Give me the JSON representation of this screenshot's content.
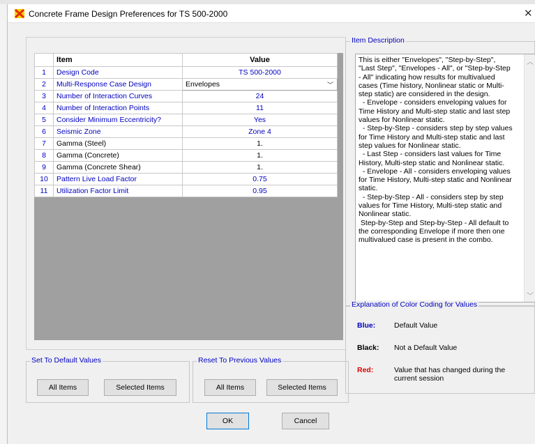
{
  "window": {
    "title": "Concrete Frame Design Preferences for TS 500-2000"
  },
  "grid": {
    "headers": [
      "",
      "Item",
      "Value"
    ],
    "rows": [
      {
        "num": "1",
        "item": "Design Code",
        "value": "TS 500-2000"
      },
      {
        "num": "2",
        "item": "Multi-Response Case Design",
        "value": "Envelopes"
      },
      {
        "num": "3",
        "item": "Number of Interaction Curves",
        "value": "24"
      },
      {
        "num": "4",
        "item": "Number of Interaction Points",
        "value": "11"
      },
      {
        "num": "5",
        "item": "Consider Minimum Eccentricity?",
        "value": "Yes"
      },
      {
        "num": "6",
        "item": "Seismic Zone",
        "value": "Zone 4"
      },
      {
        "num": "7",
        "item": "Gamma (Steel)",
        "value": "1."
      },
      {
        "num": "8",
        "item": "Gamma (Concrete)",
        "value": "1."
      },
      {
        "num": "9",
        "item": "Gamma (Concrete Shear)",
        "value": "1."
      },
      {
        "num": "10",
        "item": "Pattern Live Load Factor",
        "value": "0.75"
      },
      {
        "num": "11",
        "item": "Utilization Factor Limit",
        "value": "0.95"
      }
    ]
  },
  "item_description": {
    "title": "Item Description",
    "text": "This is either \"Envelopes\", \"Step-by-Step\", \"Last Step\", \"Envelopes - All\", or \"Step-by-Step - All\" indicating how results for multivalued cases (Time history, Nonlinear static or Multi-step static) are considered in the design.\n  - Envelope - considers enveloping values for Time History and Multi-step static and last step values for Nonlinear static.\n  - Step-by-Step - considers step by step values for Time History and Multi-step static and last step values for Nonlinear static.\n  - Last Step - considers last values for Time History, Multi-step static and Nonlinear static.\n  - Envelope - All - considers enveloping values for Time History, Multi-step static and Nonlinear static.\n  - Step-by-Step - All - considers step by step values for Time History, Multi-step static and Nonlinear static.\n Step-by-Step and Step-by-Step - All default to the corresponding Envelope if more then one multivalued case is present in the combo."
  },
  "color_coding": {
    "title": "Explanation of Color Coding for Values",
    "blue_label": "Blue:",
    "blue_desc": "Default Value",
    "black_label": "Black:",
    "black_desc": "Not a Default Value",
    "red_label": "Red:",
    "red_desc": "Value that has changed during the current session",
    "colors": {
      "blue": "#0000c0",
      "black": "#000000",
      "red": "#e00000"
    }
  },
  "set_default": {
    "title": "Set To Default Values",
    "all": "All Items",
    "selected": "Selected Items"
  },
  "reset_previous": {
    "title": "Reset To Previous Values",
    "all": "All Items",
    "selected": "Selected Items"
  },
  "buttons": {
    "ok": "OK",
    "cancel": "Cancel"
  }
}
